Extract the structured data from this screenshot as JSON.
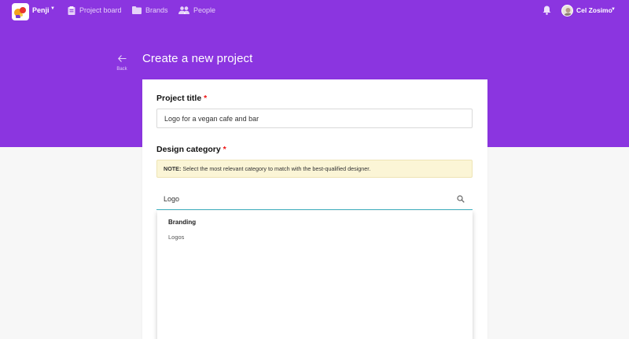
{
  "nav": {
    "brand": "Penji",
    "items": [
      {
        "label": "Project board",
        "icon": "clipboard-icon"
      },
      {
        "label": "Brands",
        "icon": "folder-icon"
      },
      {
        "label": "People",
        "icon": "people-icon"
      }
    ],
    "user_name": "Cel Zosimo"
  },
  "header": {
    "back_label": "Back",
    "title": "Create a new project"
  },
  "form": {
    "project_title_label": "Project title",
    "required_mark": "*",
    "project_title_value": "Logo for a vegan cafe and bar",
    "design_category_label": "Design category",
    "note_prefix": "NOTE:",
    "note_text": " Select the most relevant category to match with the best-qualified designer.",
    "search_value": "Logo",
    "dropdown": {
      "group": "Branding",
      "options": [
        "Logos"
      ]
    }
  },
  "colors": {
    "primary": "#8b35e0",
    "note_bg": "#fbf5d6",
    "focus": "#46b6c6",
    "required": "#e11111"
  }
}
